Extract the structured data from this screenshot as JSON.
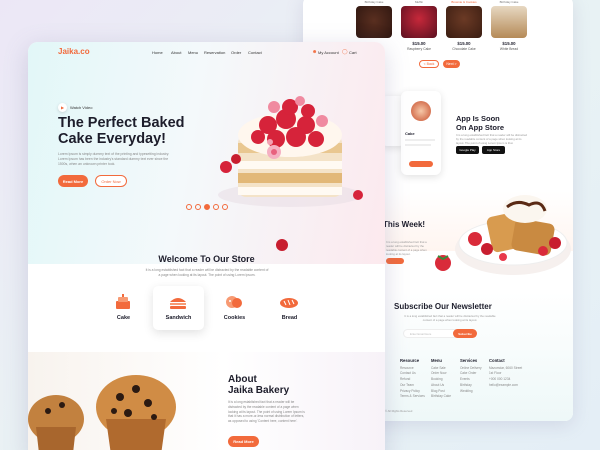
{
  "back_page": {
    "products": [
      {
        "top": "Birthday Cake",
        "price": "",
        "name": ""
      },
      {
        "top": "Muffin",
        "price": "$15.00",
        "name": "Raspberry Cake"
      },
      {
        "top": "Brownie & Cookies",
        "price": "$15.00",
        "name": "Chocolate Cake"
      },
      {
        "top": "Birthday Cake",
        "price": "$15.00",
        "name": "White Bread"
      }
    ],
    "pager": [
      "< Back",
      "Next >"
    ],
    "app_title_1": "App Is Soon",
    "app_title_2": "On App Store",
    "app_text": "It is a long established fact that a reader will be distracted by the readable content of a page when looking at its layout. The point of using Lorem Ipsum is that.",
    "google_play": "Google Play",
    "app_store": "App Store",
    "phone_label": "Cake",
    "week_title_1": "l",
    "week_title_2": "This Week!",
    "week_text": "It is a long established fact that a reader will be distracted by the readable content of a page when looking at its layout.",
    "newsletter_title": "Subscribe Our Newsletter",
    "newsletter_text": "It is a long established fact that a reader will be distracted by the readable content of a page when looking at its layout.",
    "email_placeholder": "Enter Email Here",
    "subscribe": "Subscribe",
    "footer": {
      "resource": {
        "title": "Resource",
        "items": [
          "Resource",
          "Contact Us",
          "Refund",
          "Our Team",
          "Privacy Policy",
          "Terms & Services"
        ]
      },
      "menu": {
        "title": "Menu",
        "items": [
          "Cake Sale",
          "Order Now",
          "Booking",
          "About Us",
          "Blog Post",
          "Birthday Cake"
        ]
      },
      "services": {
        "title": "Services",
        "items": [
          "Online Delivery",
          "Cake Order",
          "Events",
          "Birthday",
          "Wedding"
        ]
      },
      "contact": {
        "title": "Contact",
        "items": [
          "Mazumdar, 6060 Street",
          "1st Floor",
          "+000 000 1234",
          "hello@example.com"
        ]
      },
      "copyright": "© All Rights Reserved"
    }
  },
  "front_page": {
    "logo": "Jaika.co",
    "nav": [
      "Home",
      "About",
      "Menu",
      "Reservation",
      "Order",
      "Contact"
    ],
    "my_account": "My Account",
    "cart": "Cart",
    "watch_video": "Watch Video",
    "hero_title_1": "The Perfect Baked",
    "hero_title_2": "Cake Everyday!",
    "hero_text": "Lorem Ipsum is simply dummy text of the printing and typesetting industry. Lorem Ipsum has been the industry's standard dummy text ever since the 1500s, when an unknown printer took.",
    "read_more": "Read More",
    "order_now": "Order Now",
    "welcome_title": "Welcome To Our Store",
    "welcome_text": "It is a long established fact that a reader will be distracted by the readable content of a page when looking at its layout. The point of using Lorem Ipsum.",
    "categories": [
      "Cake",
      "Sandwich",
      "Cookies",
      "Bread"
    ],
    "about_title_1": "About",
    "about_title_2": "Jaika Bakery",
    "about_text": "It is a long established fact that a reader will be distracted by the readable content of a page when looking at its layout. The point of using Lorem Ipsum is that it has a more-or-less normal distribution of letters, as opposed to using 'Content here, content here'.",
    "about_read_more": "Read More"
  },
  "colors": {
    "accent": "#f26a3c",
    "dark": "#1d1d2b"
  }
}
